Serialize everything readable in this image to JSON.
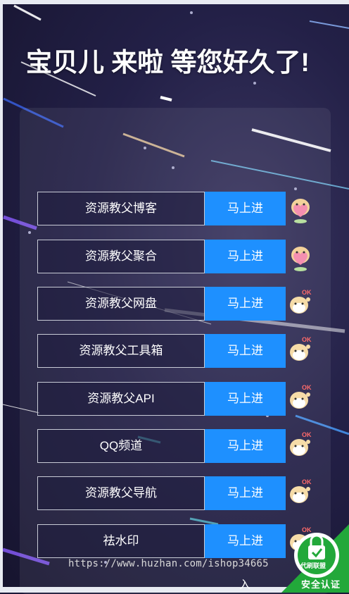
{
  "page": {
    "title": "宝贝儿 来啦 等您好久了!"
  },
  "links": [
    {
      "name": "资源教父博客",
      "action": "马上进",
      "sticker": "heart-dog-sticker"
    },
    {
      "name": "资源教父聚合",
      "action": "马上进",
      "sticker": "heart-dog-sticker"
    },
    {
      "name": "资源教父网盘",
      "action": "马上进",
      "sticker": "ok-dog-sticker"
    },
    {
      "name": "资源教父工具箱",
      "action": "马上进",
      "sticker": "ok-dog-sticker"
    },
    {
      "name": "资源教父API",
      "action": "马上进",
      "sticker": "ok-dog-sticker"
    },
    {
      "name": "QQ频道",
      "action": "马上进",
      "sticker": "ok-dog-sticker"
    },
    {
      "name": "资源教父导航",
      "action": "马上进",
      "sticker": "ok-dog-sticker"
    },
    {
      "name": "祛水印",
      "action": "马上进",
      "sticker": "ok-dog-sticker"
    }
  ],
  "overlay": {
    "watermark": "https://www.huzhan.com/ishop34665",
    "tail_char": "入",
    "badge_label": "代刷联盟",
    "badge_text": "安全认证"
  },
  "sticker_text": "OK",
  "colors": {
    "button": "#1e90ff",
    "background": "#1b1838",
    "badge": "#22a83a"
  }
}
